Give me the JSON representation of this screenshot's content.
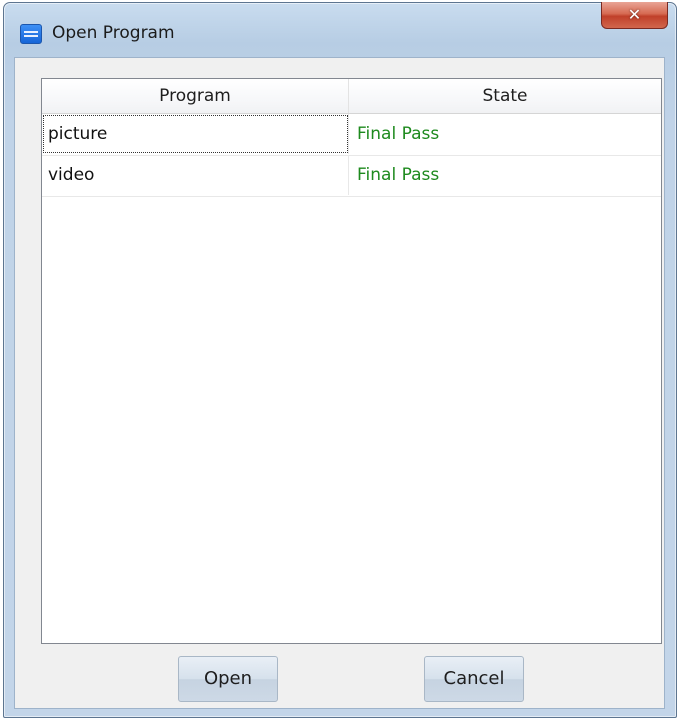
{
  "window": {
    "title": "Open Program",
    "close_glyph": "✕"
  },
  "table": {
    "columns": [
      "Program",
      "State"
    ],
    "rows": [
      {
        "program": "picture",
        "state": "Final Pass"
      },
      {
        "program": "video",
        "state": "Final Pass"
      }
    ],
    "state_color": "#1e8a1e"
  },
  "buttons": {
    "open_label": "Open",
    "cancel_label": "Cancel"
  }
}
